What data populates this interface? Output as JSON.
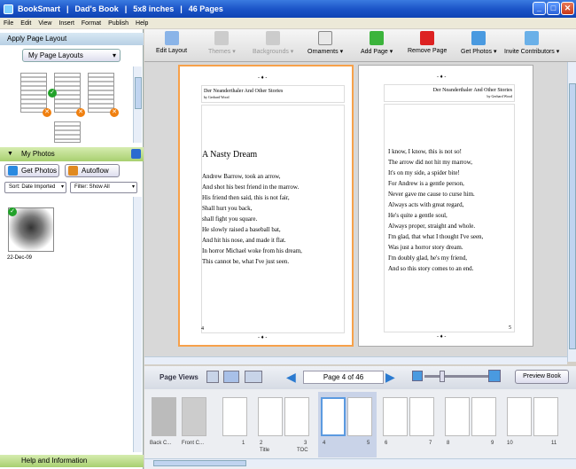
{
  "titlebar": {
    "app": "BookSmart",
    "book": "Dad's Book",
    "size": "5x8 inches",
    "pages": "46 Pages"
  },
  "menu": [
    "File",
    "Edit",
    "View",
    "Insert",
    "Format",
    "Publish",
    "Help"
  ],
  "left": {
    "apply_layout": "Apply Page Layout",
    "layout_select": "My Page Layouts",
    "my_photos": "My Photos",
    "get_photos": "Get Photos",
    "autoflow": "Autoflow",
    "sort": "Sort: Date Imported",
    "filter": "Filter: Show All",
    "photo_date": "22-Dec-09",
    "help": "Help and Information"
  },
  "toolbar": {
    "edit_layout": "Edit Layout",
    "themes": "Themes ▾",
    "backgrounds": "Backgrounds ▾",
    "ornaments": "Ornaments ▾",
    "add_page": "Add Page ▾",
    "remove_page": "Remove Page",
    "get_photos": "Get Photos ▾",
    "invite": "Invite Contributors ▾"
  },
  "left_page": {
    "header": "Der Neanderthaler And Other Stories",
    "author": "by Gerhard Wood",
    "title": "A Nasty Dream",
    "lines": [
      "Andrew Barrow, took an arrow,",
      "And shot his best friend in the marrow.",
      "His friend then said, this is not fair,",
      "Shall hurt you back,",
      "shall fight you square.",
      "He slowly raised a baseball bat,",
      "And hit his nose, and made it flat.",
      "In horror Michael woke from his dream,",
      "This cannot be, what I've just seen."
    ],
    "number": "4"
  },
  "right_page": {
    "header": "Der Neanderthaler And Other Stories",
    "author": "by Gerhard Wood",
    "lines": [
      "I know, I know, this is not so!",
      "The arrow did not hit my marrow,",
      "It's on my side, a spider bite!",
      "For Andrew is a gentle person,",
      "Never gave me cause to curse him.",
      "Always acts with great regard,",
      "He's quite a gentle soul,",
      "Always proper, straight and whole.",
      "I'm glad, that what I thought I've seen,",
      "Was just a horror story dream.",
      "I'm doubly glad, he's my friend,",
      "And so this story comes to an end."
    ],
    "number": "5"
  },
  "nav": {
    "page_views": "Page Views",
    "page_indicator": "Page 4 of 46",
    "preview": "Preview Book"
  },
  "filmstrip": {
    "labels": [
      "Back C...",
      "Front C...",
      "1",
      "2",
      "3",
      "4",
      "5",
      "6",
      "7",
      "8",
      "9",
      "10",
      "11"
    ],
    "sublabels": {
      "2": "Title",
      "3": "TOC"
    }
  }
}
